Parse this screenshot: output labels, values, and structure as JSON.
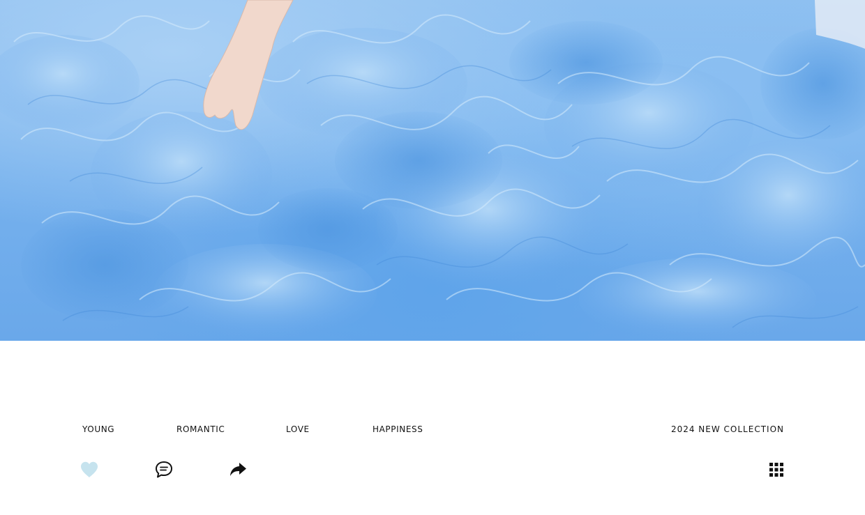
{
  "hero": {
    "image": "blue-tulle-ruffle-gown-photo",
    "colors": {
      "main": "#76b1ed",
      "light": "#a9d0f5",
      "deep": "#5a9fe6"
    }
  },
  "tags": {
    "young": "YOUNG",
    "romantic": "ROMANTIC",
    "love": "LOVE",
    "happiness": "HAPPINESS"
  },
  "collection_label": "2024 NEW COLLECTION",
  "actions": {
    "like_icon": "heart-icon",
    "like_color": "#c6e3ee",
    "comment_icon": "chat-bubble-icon",
    "share_icon": "share-arrow-icon",
    "grid_icon": "grid-menu-icon"
  }
}
